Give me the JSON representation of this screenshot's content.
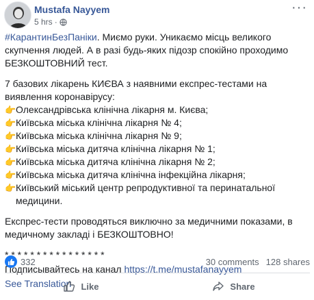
{
  "post": {
    "author": "Mustafa Nayyem",
    "time": "5 hrs",
    "separator": "·",
    "more": "···",
    "hashtag": "#КарантинБезПаніки",
    "para1_rest": ". Миємо руки. Уникаємо місць великого скупчення людей. А в разі будь-яких підозр спокійно проходимо БЕЗКОШТОВНИЙ тест.",
    "para2": "7 базових лікарень КИЄВА з наявними експрес-тестами на виявлення коронавірусу:",
    "hospitals": [
      "Олександрівська клінічна лікарня м. Києва;",
      "Київська міська клінічна лікарня № 4;",
      "Київська міська клінічна лікарня № 9;",
      "Київська міська дитяча клінічна лікарня № 1;",
      "Київська міська дитяча клінічна лікарня № 2;",
      "Київська міська дитяча клінічна інфекційна лікарня;",
      "Київський міський центр репродуктивної та перинатальної медицини."
    ],
    "list_bullet": "👉",
    "para3": "Експрес-тести проводяться виключно за медичними показами, в медичному закладі і БЕЗКОШТОВНО!",
    "stars": "* * * * * * * * * * * * * * * *",
    "subscribe_text": "Подписывайтесь на канал ",
    "subscribe_link": "https://t.me/mustafanayyem",
    "see_translation": "See Translation"
  },
  "stats": {
    "likes": "332",
    "comments": "30 comments",
    "shares": "128 shares"
  },
  "actions": {
    "like": "Like",
    "share": "Share"
  },
  "colors": {
    "link": "#385898",
    "like_blue": "#1877f2",
    "muted": "#606770"
  }
}
